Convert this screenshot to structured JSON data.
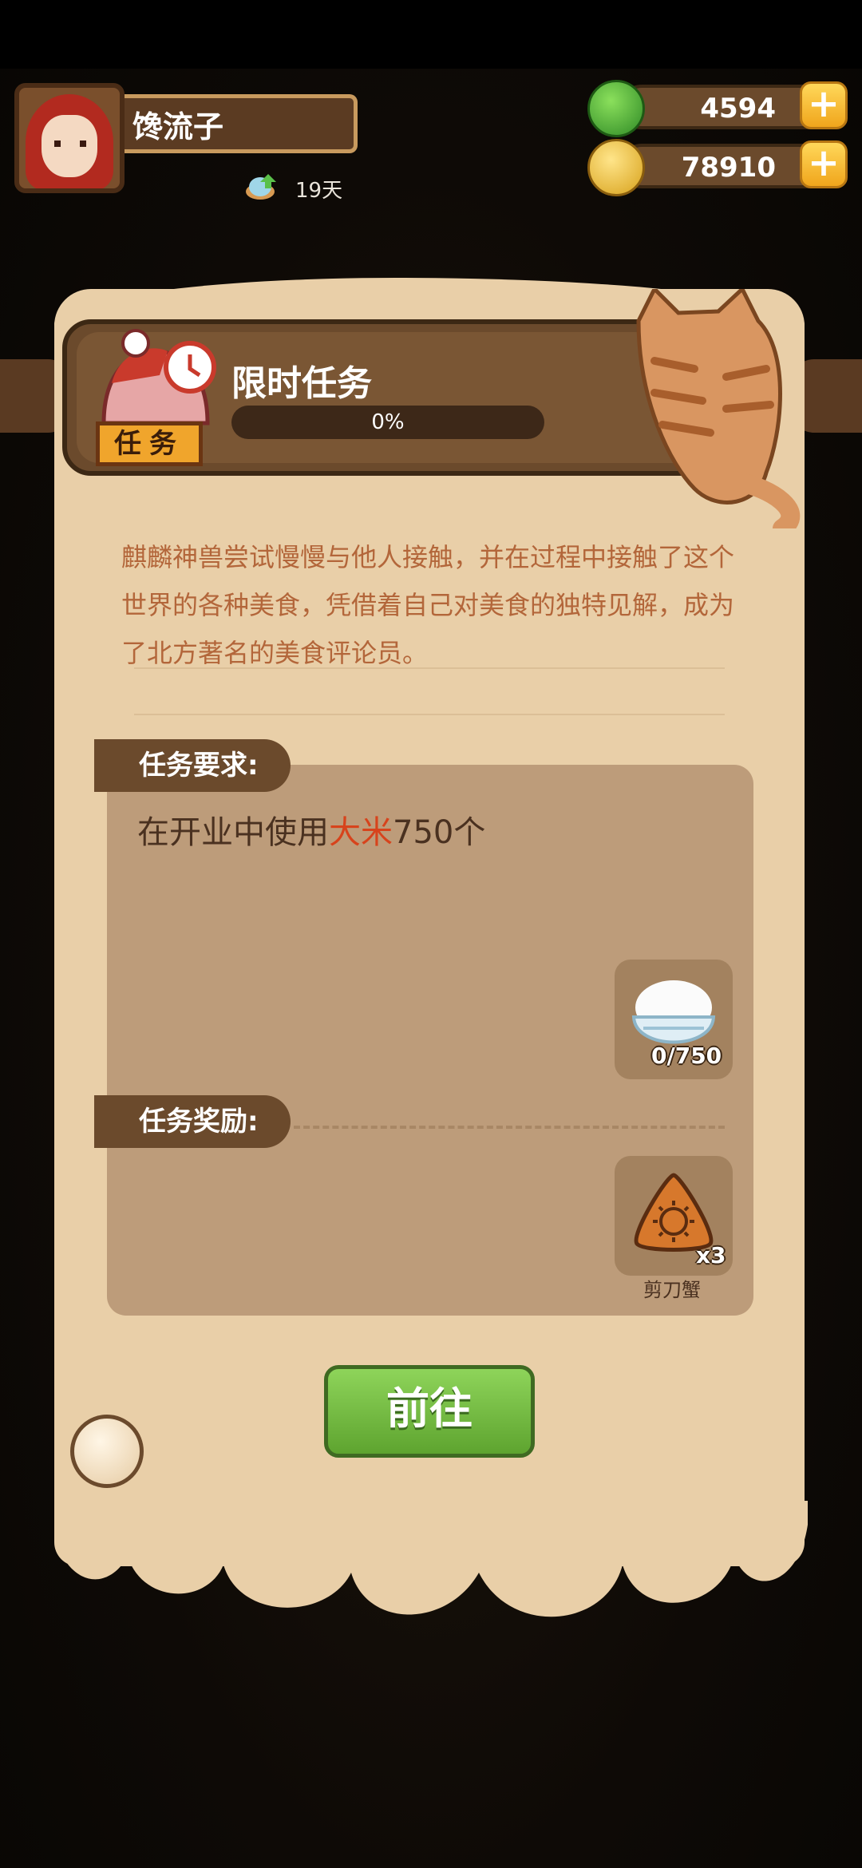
{
  "player": {
    "name": "馋流子",
    "days": "19天"
  },
  "currency": {
    "gems": {
      "value": "4594",
      "icon": "green-apple-icon"
    },
    "coins": {
      "value": "78910",
      "icon": "coin-icon"
    }
  },
  "mission": {
    "tag": "任务",
    "title": "限时任务",
    "progress_text": "0%",
    "progress": 0,
    "description": "麒麟神兽尝试慢慢与他人接触，并在过程中接触了这个世界的各种美食，凭借着自己对美食的独特见解，成为了北方著名的美食评论员。",
    "requirement_label": "任务要求:",
    "requirement": {
      "prefix": "在开业中使用",
      "highlight": "大米",
      "suffix": "750个"
    },
    "requirement_item": {
      "icon": "rice-bowl-icon",
      "count": "0/750"
    },
    "reward_label": "任务奖励:",
    "reward_item": {
      "icon": "sun-triangle-icon",
      "count": "x3",
      "name": "剪刀蟹"
    },
    "go_button": "前往"
  },
  "colors": {
    "highlight": "#d7431c",
    "description": "#b3663a",
    "button_green": "#6fb63c"
  }
}
